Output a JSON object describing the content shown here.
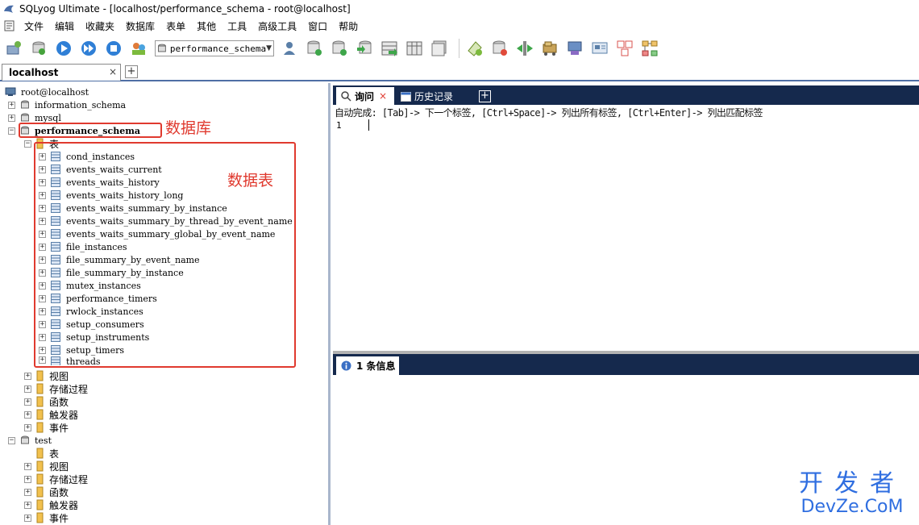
{
  "window": {
    "title": "SQLyog Ultimate - [localhost/performance_schema - root@localhost]"
  },
  "menu": {
    "items": [
      "文件",
      "编辑",
      "收藏夹",
      "数据库",
      "表单",
      "其他",
      "工具",
      "高级工具",
      "窗口",
      "帮助"
    ]
  },
  "toolbar": {
    "database_select": "performance_schema",
    "left_icons": [
      "new-connection-icon",
      "refresh-icon",
      "execute-query-icon",
      "execute-all-icon",
      "stop-icon",
      "users-icon"
    ],
    "right_icons": [
      "user-manager-icon",
      "backup-db-icon",
      "restore-db-icon",
      "import-icon",
      "table-data-icon",
      "schema-designer-icon",
      "query-builder-icon",
      "data-sync-icon",
      "schema-sync-icon",
      "import-external-icon",
      "scheduled-backup-icon",
      "notifications-icon",
      "data-search-icon",
      "sql-formatter-icon",
      "job-agent-icon"
    ]
  },
  "connection_tab": {
    "label": "localhost",
    "close": "×",
    "add": "+"
  },
  "tree": {
    "root": "root@localhost",
    "databases": [
      {
        "name": "information_schema"
      },
      {
        "name": "mysql"
      },
      {
        "name": "performance_schema"
      },
      {
        "name": "test"
      }
    ],
    "tables_folder": "表",
    "tables": [
      "cond_instances",
      "events_waits_current",
      "events_waits_history",
      "events_waits_history_long",
      "events_waits_summary_by_instance",
      "events_waits_summary_by_thread_by_event_name",
      "events_waits_summary_global_by_event_name",
      "file_instances",
      "file_summary_by_event_name",
      "file_summary_by_instance",
      "mutex_instances",
      "performance_timers",
      "rwlock_instances",
      "setup_consumers",
      "setup_instruments",
      "setup_timers",
      "threads"
    ],
    "folders": [
      "视图",
      "存储过程",
      "函数",
      "触发器",
      "事件"
    ],
    "test_folders": [
      "表",
      "视图",
      "存储过程",
      "函数",
      "触发器",
      "事件"
    ]
  },
  "annotations": {
    "database": "数据库",
    "tables": "数据表",
    "color": "#e03a2f"
  },
  "query_tabs": {
    "query": "询问",
    "history": "历史记录",
    "close": "×",
    "add": "+"
  },
  "editor": {
    "hint": "自动完成: [Tab]-> 下一个标签, [Ctrl+Space]-> 列出所有标签, [Ctrl+Enter]-> 列出匹配标签",
    "line_number": "1"
  },
  "result_tab": {
    "label": "1 条信息"
  },
  "watermark": {
    "top": "开发者",
    "bottom": "DevZe.CoM"
  },
  "colors": {
    "tab_bar_bg": "#15294d",
    "accent_blue": "#4f6fa5",
    "watermark": "#2f6ee0"
  }
}
